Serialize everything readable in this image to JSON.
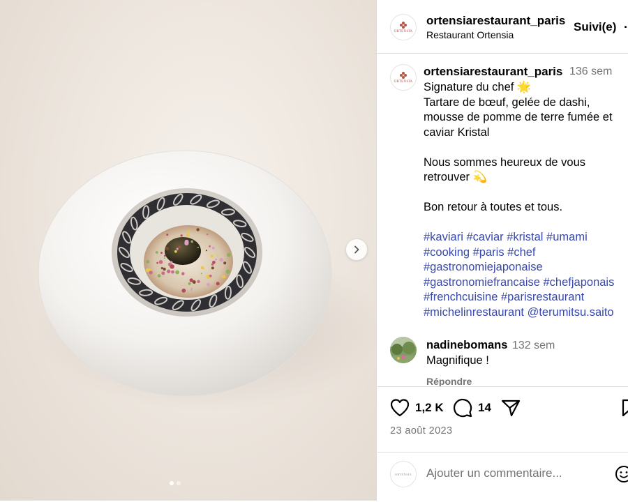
{
  "header": {
    "username": "ortensiarestaurant_paris",
    "subtitle": "Restaurant Ortensia",
    "follow_label": "Suivi(e)",
    "more_label": "···",
    "logo_text": "ORTENSIA"
  },
  "caption": {
    "username": "ortensiarestaurant_paris",
    "time": "136 sem",
    "lines": [
      "Signature du chef 🌟",
      "Tartare de bœuf, gelée de dashi,",
      "mousse de pomme de terre fumée et",
      "caviar Kristal",
      "Nous sommes heureux de vous",
      "retrouver 💫",
      "Bon retour à toutes et tous."
    ],
    "hashtags": [
      "#kaviari #caviar #kristal #umami",
      "#cooking #paris #chef",
      "#gastronomiejaponaise",
      "#gastronomiefrancaise #chefjaponais",
      "#frenchcuisine #parisrestaurant",
      "#michelinrestaurant @terumitsu.saito"
    ]
  },
  "comment": {
    "username": "nadinebomans",
    "time": "132 sem",
    "text": "Magnifique !",
    "reply_label": "Répondre"
  },
  "actions": {
    "likes": "1,2 K",
    "comments": "14",
    "date": "23 août 2023",
    "icons": [
      "heart-icon",
      "comment-icon",
      "share-icon",
      "bookmark-icon"
    ]
  },
  "add_comment": {
    "placeholder": "Ajouter un commentaire...",
    "icon": "emoji-icon"
  },
  "media": {
    "slides": 2,
    "current_slide": 1
  },
  "colors": {
    "hashtag": "#3949ab",
    "muted": "#737373",
    "border": "#dbdbdb",
    "logo": "#b5524a"
  }
}
